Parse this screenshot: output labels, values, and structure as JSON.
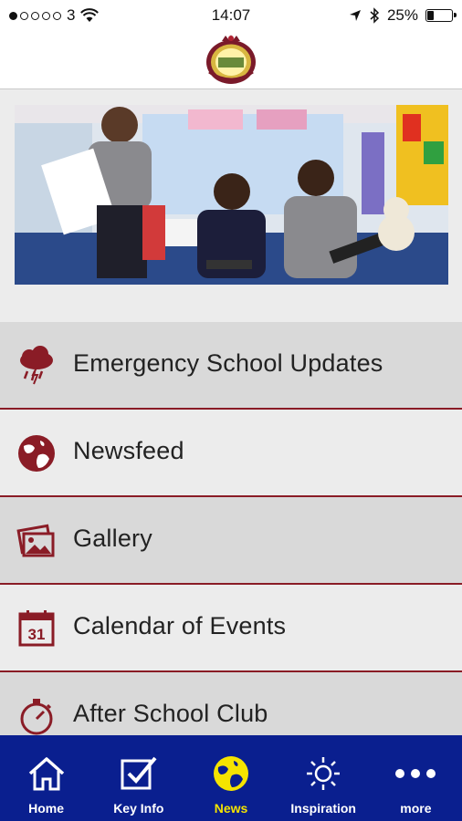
{
  "status_bar": {
    "carrier": "3",
    "signal_dots_filled": 1,
    "signal_dots_total": 5,
    "time": "14:07",
    "battery_percent": "25%",
    "battery_level": 0.25
  },
  "header": {
    "logo_icon": "school-crest-icon"
  },
  "hero": {
    "image_icon": "children-reading-photo"
  },
  "menu": {
    "items": [
      {
        "label": "Emergency School Updates",
        "icon": "storm-cloud-icon"
      },
      {
        "label": "Newsfeed",
        "icon": "globe-icon"
      },
      {
        "label": "Gallery",
        "icon": "photos-icon"
      },
      {
        "label": "Calendar of Events",
        "icon": "calendar-icon",
        "icon_text": "31"
      },
      {
        "label": "After School Club",
        "icon": "stopwatch-icon"
      }
    ]
  },
  "tabbar": {
    "tabs": [
      {
        "label": "Home",
        "icon": "home-icon"
      },
      {
        "label": "Key Info",
        "icon": "checkbox-icon"
      },
      {
        "label": "News",
        "icon": "globe-icon",
        "active": true
      },
      {
        "label": "Inspiration",
        "icon": "sun-icon"
      },
      {
        "label": "more",
        "icon": "more-dots-icon"
      }
    ]
  },
  "colors": {
    "accent": "#8a1c26",
    "tabbar_bg": "#0a1f8f",
    "active_tab": "#f5e400"
  }
}
